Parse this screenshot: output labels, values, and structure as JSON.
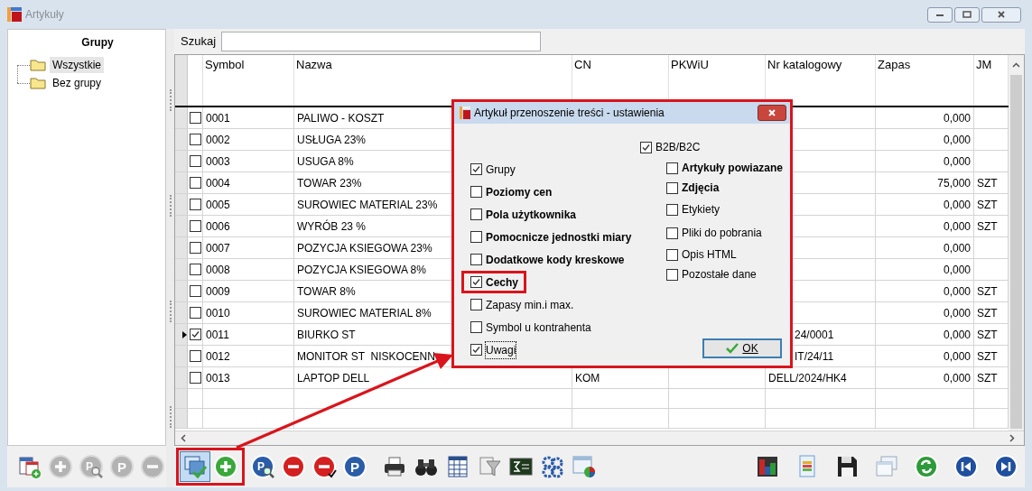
{
  "window": {
    "title": "Artykuły",
    "active": false
  },
  "groups_panel": {
    "title": "Grupy",
    "items": [
      {
        "label": "Wszystkie",
        "selected": true
      },
      {
        "label": "Bez grupy",
        "selected": false
      }
    ],
    "toolbar": [
      {
        "kind": "add-table",
        "disabled": false
      },
      {
        "kind": "plus",
        "disabled": true
      },
      {
        "kind": "search-p",
        "glyph": "P",
        "disabled": true
      },
      {
        "kind": "p",
        "glyph": "P",
        "disabled": true
      },
      {
        "kind": "minus",
        "disabled": true
      }
    ]
  },
  "search": {
    "label": "Szukaj"
  },
  "table": {
    "columns": [
      "Symbol",
      "Nazwa",
      "CN",
      "PKWiU",
      "Nr katalogowy",
      "Zapas",
      "JM"
    ],
    "rows": [
      {
        "checked": false,
        "current": false,
        "symbol": "0001",
        "nazwa": "PALIWO - KOSZT",
        "zapas": "0,000"
      },
      {
        "checked": false,
        "current": false,
        "symbol": "0002",
        "nazwa": "USŁUGA 23%",
        "zapas": "0,000"
      },
      {
        "checked": false,
        "current": false,
        "symbol": "0003",
        "nazwa": "USUGA 8%",
        "zapas": "0,000"
      },
      {
        "checked": false,
        "current": false,
        "symbol": "0004",
        "nazwa": "TOWAR 23%",
        "zapas": "75,000",
        "jm": "SZT"
      },
      {
        "checked": false,
        "current": false,
        "symbol": "0005",
        "nazwa": "SUROWIEC MATERIAL 23%",
        "zapas": "0,000",
        "jm": "SZT"
      },
      {
        "checked": false,
        "current": false,
        "symbol": "0006",
        "nazwa": "WYRÓB 23 %",
        "zapas": "0,000",
        "jm": "SZT"
      },
      {
        "checked": false,
        "current": false,
        "symbol": "0007",
        "nazwa": "POZYCJA KSIEGOWA 23%",
        "zapas": "0,000"
      },
      {
        "checked": false,
        "current": false,
        "symbol": "0008",
        "nazwa": "POZYCJA KSIEGOWA 8%",
        "zapas": "0,000"
      },
      {
        "checked": false,
        "current": false,
        "symbol": "0009",
        "nazwa": "TOWAR 8%",
        "zapas": "0,000",
        "jm": "SZT"
      },
      {
        "checked": false,
        "current": false,
        "symbol": "0010",
        "nazwa": "SUROWIEC MATERIAL 8%",
        "zapas": "0,000",
        "jm": "SZT"
      },
      {
        "checked": true,
        "current": true,
        "symbol": "0011",
        "nazwa": "BIURKO ST",
        "nr": "24/0001",
        "nr_cut": true,
        "zapas": "0,000",
        "jm": "SZT"
      },
      {
        "checked": false,
        "current": false,
        "symbol": "0012",
        "nazwa": "MONITOR ST  NISKOCENN",
        "nr": "IT/24/11",
        "nr_cut": true,
        "zapas": "0,000",
        "jm": "SZT"
      },
      {
        "checked": false,
        "current": false,
        "symbol": "0013",
        "nazwa": "LAPTOP DELL",
        "cn": "KOM",
        "nr": "DELL/2024/HK4",
        "zapas": "0,000",
        "jm": "SZT"
      }
    ]
  },
  "toolbar": [
    {
      "highlighted": true,
      "items": [
        {
          "kind": "transfer",
          "pressed": true
        },
        {
          "kind": "plus",
          "pressed": false
        }
      ]
    },
    {
      "items": [
        {
          "kind": "search-p",
          "glyph": "P"
        },
        {
          "kind": "minus"
        },
        {
          "kind": "minus-check"
        },
        {
          "kind": "p",
          "glyph": "P"
        }
      ]
    },
    {
      "items": [
        {
          "kind": "printer"
        },
        {
          "kind": "binoculars"
        },
        {
          "kind": "grid"
        },
        {
          "kind": "funnel"
        },
        {
          "kind": "sigma"
        },
        {
          "kind": "gears"
        },
        {
          "kind": "window-pie"
        }
      ]
    },
    {
      "items": [
        {
          "kind": "bar-chart"
        },
        {
          "kind": "document"
        },
        {
          "kind": "save"
        },
        {
          "kind": "windows"
        },
        {
          "kind": "refresh"
        },
        {
          "kind": "first"
        },
        {
          "kind": "last"
        }
      ]
    }
  ],
  "dialog": {
    "title": "Artykuł przenoszenie treści - ustawienia",
    "highlighted": true,
    "left_options": [
      {
        "label": "Grupy",
        "checked": true,
        "bold": false,
        "highlighted": false,
        "focused": false
      },
      {
        "label": "Poziomy cen",
        "checked": false,
        "bold": true,
        "highlighted": false,
        "focused": false
      },
      {
        "label": "Pola użytkownika",
        "checked": false,
        "bold": true,
        "highlighted": false,
        "focused": false
      },
      {
        "label": "Pomocnicze jednostki miary",
        "checked": false,
        "bold": true,
        "highlighted": false,
        "focused": false
      },
      {
        "label": "Dodatkowe kody kreskowe",
        "checked": false,
        "bold": true,
        "highlighted": false,
        "focused": false
      },
      {
        "label": "Cechy",
        "checked": true,
        "bold": true,
        "highlighted": true,
        "focused": false
      },
      {
        "label": "Zapasy min.i max.",
        "checked": false,
        "bold": false,
        "highlighted": false,
        "focused": false
      },
      {
        "label": "Symbol u kontrahenta",
        "checked": false,
        "bold": false,
        "highlighted": false,
        "focused": false
      },
      {
        "label": "Uwagi",
        "checked": true,
        "bold": false,
        "highlighted": false,
        "focused": true
      }
    ],
    "b2b": {
      "label": "B2B/B2C",
      "checked": true
    },
    "right_options": [
      {
        "label": "Artykuły powiazane",
        "checked": false,
        "bold": true
      },
      {
        "label": "Zdjęcia",
        "checked": false,
        "bold": true
      },
      {
        "label": "Etykiety",
        "checked": false,
        "bold": false
      },
      {
        "label": "Pliki do pobrania",
        "checked": false,
        "bold": false
      },
      {
        "label": "Opis HTML",
        "checked": false,
        "bold": false
      },
      {
        "label": "Pozostałe dane",
        "checked": false,
        "bold": false
      }
    ],
    "ok_button": "OK"
  }
}
